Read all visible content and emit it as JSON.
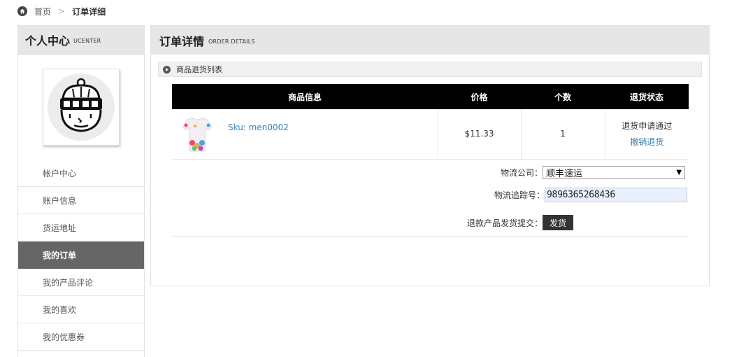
{
  "breadcrumb": {
    "home": "首页",
    "separator": ">",
    "current": "订单详细"
  },
  "sidebar": {
    "title": "个人中心",
    "subtitle": "UCENTER",
    "menu": [
      {
        "label": "帐户中心",
        "active": false
      },
      {
        "label": "账户信息",
        "active": false
      },
      {
        "label": "货运地址",
        "active": false
      },
      {
        "label": "我的订单",
        "active": true
      },
      {
        "label": "我的产品评论",
        "active": false
      },
      {
        "label": "我的喜欢",
        "active": false
      },
      {
        "label": "我的优惠券",
        "active": false
      }
    ]
  },
  "panel": {
    "title": "订单详情",
    "subtitle": "ORDER DETAILS",
    "section_label": "商品退货列表",
    "table": {
      "headers": [
        "商品信息",
        "价格",
        "个数",
        "退货状态"
      ],
      "rows": [
        {
          "sku": "Sku: men0002",
          "price": "$11.33",
          "qty": "1",
          "status": "退货申请通过",
          "action": "撤销退货"
        }
      ]
    },
    "form": {
      "carrier_label": "物流公司：",
      "carrier_value": "顺丰速运",
      "tracking_label": "物流追踪号：",
      "tracking_value": "9896365268436",
      "submit_label": "退款产品发货提交：",
      "submit_button": "发货"
    }
  },
  "icons": {
    "home": "home-icon",
    "section": "play-circle-icon",
    "avatar": "avatar-beanie-face-icon",
    "dropdown": "triangle-down-icon"
  },
  "colors": {
    "active_menu_bg": "#666666",
    "header_bg": "#e6e6e6",
    "table_head_bg": "#000000",
    "link": "#3a7fb0"
  }
}
